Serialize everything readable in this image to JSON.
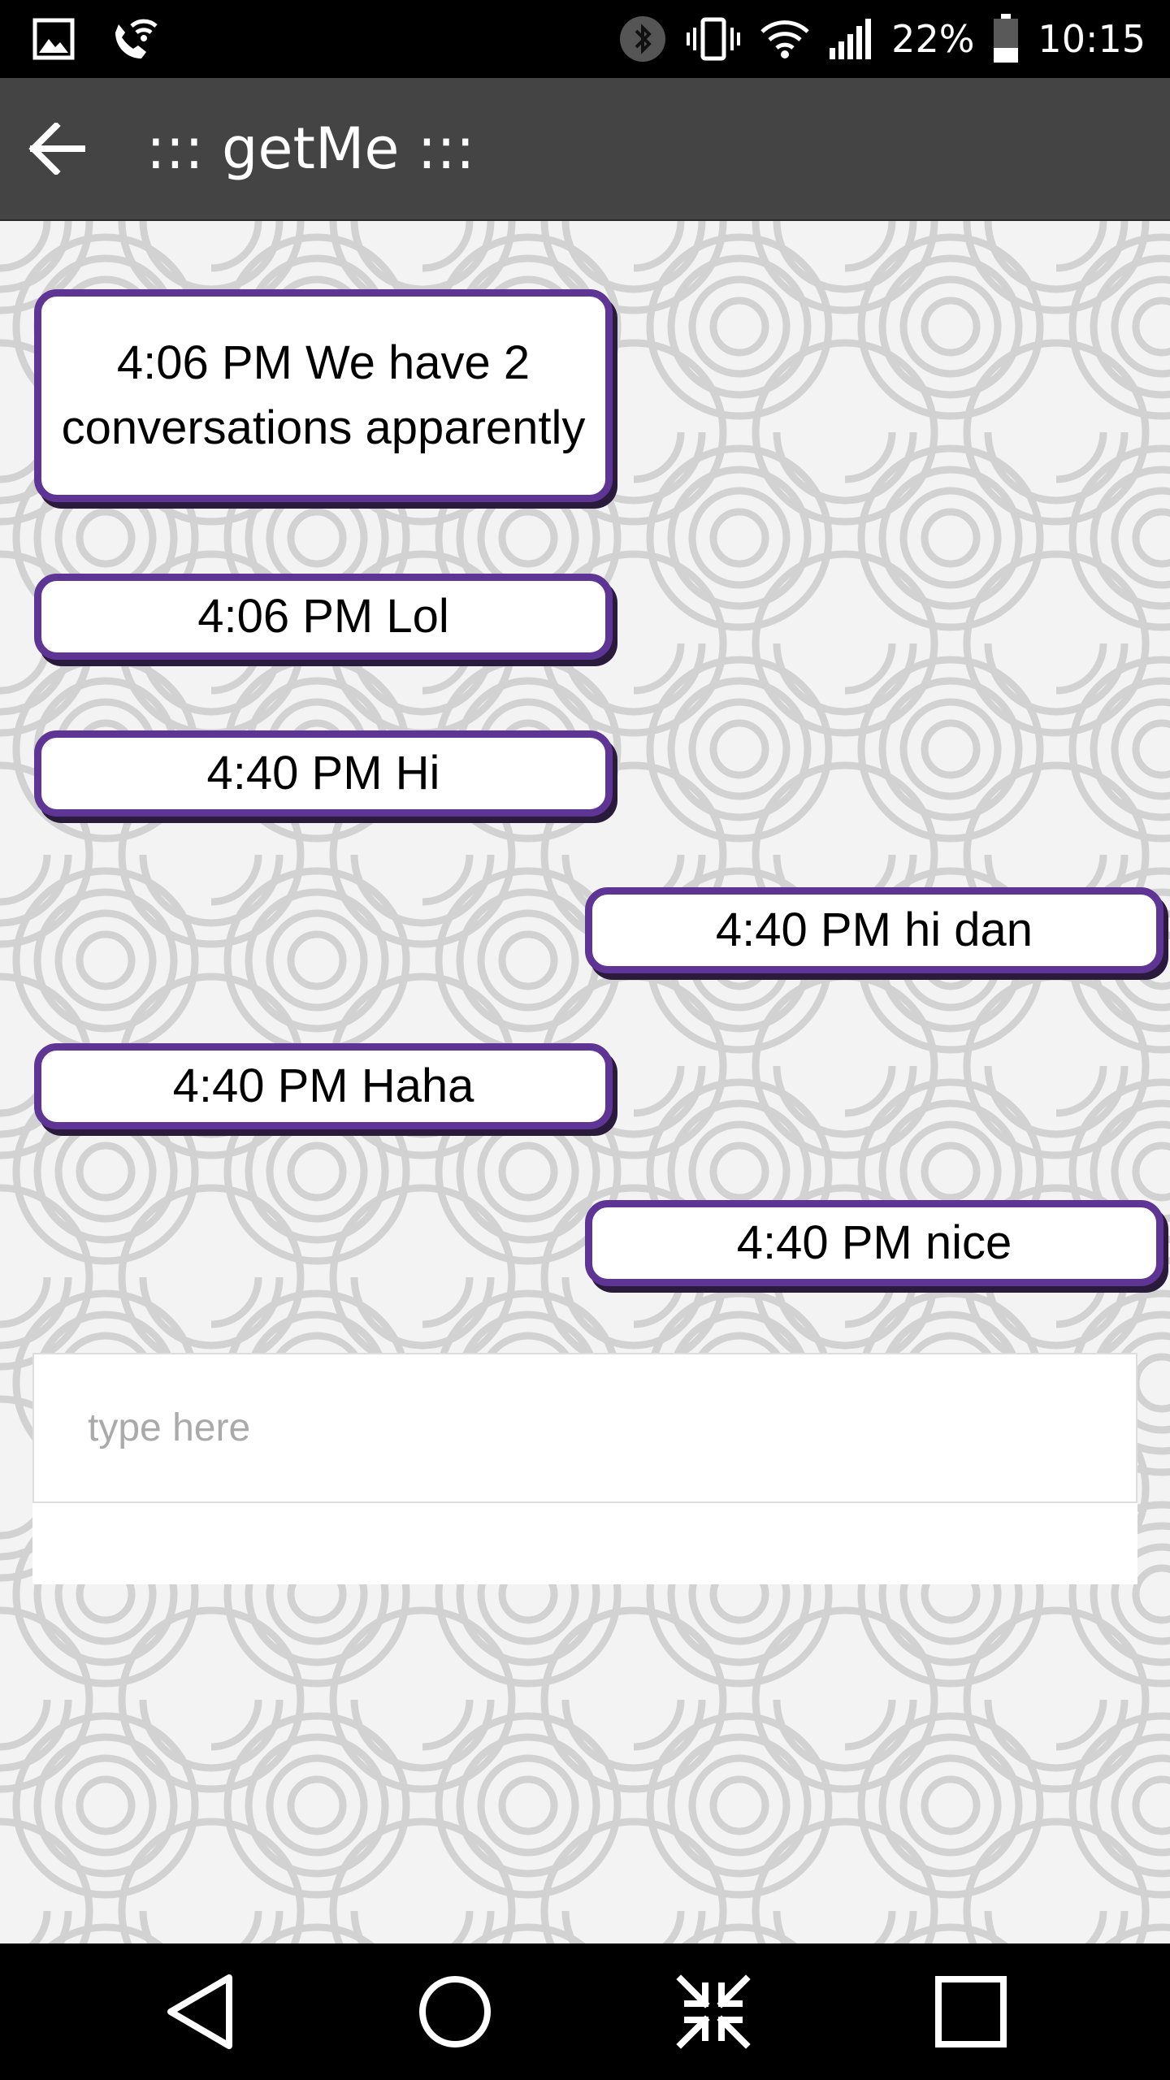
{
  "status_bar": {
    "battery": "22%",
    "time": "10:15",
    "icons": [
      "gallery-icon",
      "wifi-calling-icon",
      "bluetooth-icon",
      "vibrate-icon",
      "wifi-icon",
      "signal-icon",
      "battery-icon"
    ]
  },
  "app_bar": {
    "title": "::: getMe :::",
    "back_icon": "arrow-back-icon"
  },
  "messages": [
    {
      "side": "left",
      "text": "4:06 PM We have 2 conversations apparently"
    },
    {
      "side": "left",
      "text": "4:06 PM Lol"
    },
    {
      "side": "left",
      "text": "4:40 PM Hi"
    },
    {
      "side": "right",
      "text": "4:40 PM hi dan"
    },
    {
      "side": "left",
      "text": "4:40 PM Haha"
    },
    {
      "side": "right",
      "text": "4:40 PM nice"
    }
  ],
  "composer": {
    "placeholder": "type here",
    "value": ""
  },
  "nav_bar": {
    "icons": [
      "nav-back-icon",
      "home-icon",
      "collapse-icon",
      "recents-icon"
    ]
  },
  "colors": {
    "bubble_border": "#5e3594",
    "bubble_shadow": "#2a1a3c",
    "app_bar": "#444444"
  }
}
